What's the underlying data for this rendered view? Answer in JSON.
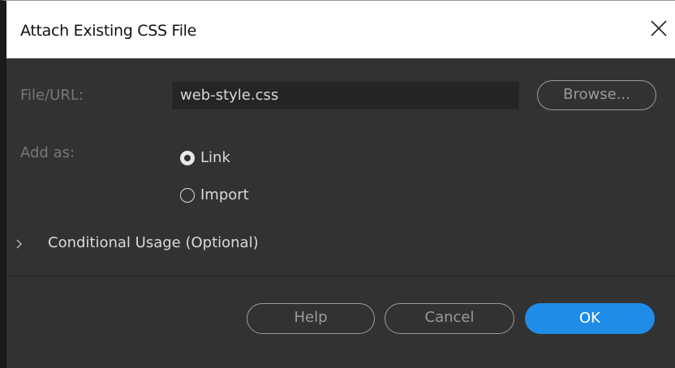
{
  "dialog": {
    "title": "Attach Existing CSS File",
    "close_icon": "close-icon"
  },
  "file_url": {
    "label": "File/URL:",
    "value": "web-style.css",
    "browse_label": "Browse..."
  },
  "add_as": {
    "label": "Add as:",
    "options": [
      {
        "label": "Link",
        "checked": true
      },
      {
        "label": "Import",
        "checked": false
      }
    ]
  },
  "conditional": {
    "label": "Conditional Usage (Optional)",
    "expanded": false,
    "icon": "chevron-right-icon"
  },
  "buttons": {
    "help": "Help",
    "cancel": "Cancel",
    "ok": "OK"
  },
  "colors": {
    "background": "#323232",
    "accent": "#1f8ce8",
    "label": "#787878",
    "text": "#d9d9d9"
  }
}
